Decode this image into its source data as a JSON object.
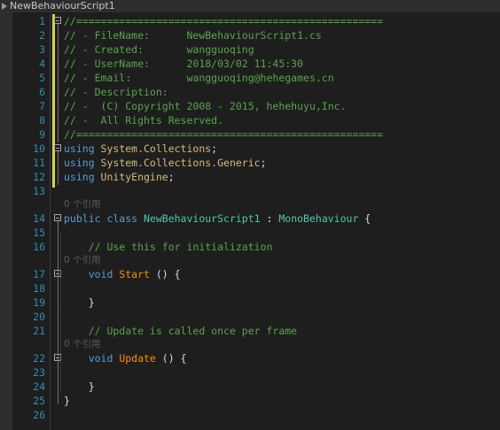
{
  "window": {
    "tab_title": "NewBehaviourScript1"
  },
  "editor": {
    "header_lines": [
      {
        "n": "1",
        "parts": [
          {
            "c": "cm",
            "t": "//=================================================="
          }
        ]
      },
      {
        "n": "2",
        "parts": [
          {
            "c": "cm",
            "t": "// - FileName:      NewBehaviourScript1.cs"
          }
        ]
      },
      {
        "n": "3",
        "parts": [
          {
            "c": "cm",
            "t": "// - Created:       wangguoqing"
          }
        ]
      },
      {
        "n": "4",
        "parts": [
          {
            "c": "cm",
            "t": "// - UserName:      2018/03/02 11:45:30"
          }
        ]
      },
      {
        "n": "5",
        "parts": [
          {
            "c": "cm",
            "t": "// - Email:         wangguoqing@hehegames.cn"
          }
        ]
      },
      {
        "n": "6",
        "parts": [
          {
            "c": "cm",
            "t": "// - Description:"
          }
        ]
      },
      {
        "n": "7",
        "parts": [
          {
            "c": "cm",
            "t": "// -  (C) Copyright 2008 - 2015, hehehuyu,Inc."
          }
        ]
      },
      {
        "n": "8",
        "parts": [
          {
            "c": "cm",
            "t": "// -  All Rights Reserved."
          }
        ]
      },
      {
        "n": "9",
        "parts": [
          {
            "c": "cm",
            "t": "//=================================================="
          }
        ]
      }
    ],
    "using_lines": [
      {
        "n": "10",
        "parts": [
          {
            "c": "kw",
            "t": "using "
          },
          {
            "c": "ns",
            "t": "System.Collections"
          },
          {
            "c": "pl",
            "t": ";"
          }
        ]
      },
      {
        "n": "11",
        "parts": [
          {
            "c": "kw",
            "t": "using "
          },
          {
            "c": "ns",
            "t": "System.Collections.Generic"
          },
          {
            "c": "pl",
            "t": ";"
          }
        ]
      },
      {
        "n": "12",
        "parts": [
          {
            "c": "kw",
            "t": "using "
          },
          {
            "c": "ns",
            "t": "UnityEngine"
          },
          {
            "c": "pl",
            "t": ";"
          }
        ]
      },
      {
        "n": "13",
        "parts": []
      }
    ],
    "class_ref": "0 个引用",
    "class_lines": [
      {
        "n": "14",
        "parts": [
          {
            "c": "kw",
            "t": "public class "
          },
          {
            "c": "ty",
            "t": "NewBehaviourScript1"
          },
          {
            "c": "pl",
            "t": " : "
          },
          {
            "c": "ty",
            "t": "MonoBehaviour"
          },
          {
            "c": "pl",
            "t": " {"
          }
        ]
      },
      {
        "n": "15",
        "parts": []
      },
      {
        "n": "16",
        "parts": [
          {
            "c": "cm",
            "t": "    // Use this for initialization"
          }
        ]
      }
    ],
    "start_ref": "0 个引用",
    "start_lines": [
      {
        "n": "17",
        "parts": [
          {
            "c": "kw",
            "t": "    void "
          },
          {
            "c": "fn",
            "t": "Start"
          },
          {
            "c": "pl",
            "t": " () {"
          }
        ]
      },
      {
        "n": "18",
        "parts": []
      },
      {
        "n": "19",
        "parts": [
          {
            "c": "pl",
            "t": "    }"
          }
        ]
      },
      {
        "n": "20",
        "parts": []
      },
      {
        "n": "21",
        "parts": [
          {
            "c": "cm",
            "t": "    // Update is called once per frame"
          }
        ]
      }
    ],
    "update_ref": "0 个引用",
    "update_lines": [
      {
        "n": "22",
        "parts": [
          {
            "c": "kw",
            "t": "    void "
          },
          {
            "c": "fn",
            "t": "Update"
          },
          {
            "c": "pl",
            "t": " () {"
          }
        ]
      },
      {
        "n": "23",
        "parts": []
      },
      {
        "n": "24",
        "parts": [
          {
            "c": "pl",
            "t": "    }"
          }
        ]
      },
      {
        "n": "25",
        "parts": [
          {
            "c": "pl",
            "t": "}"
          }
        ]
      },
      {
        "n": "26",
        "parts": []
      }
    ],
    "colors": {
      "background": "#1e1e1e",
      "line_number": "#2b91af",
      "comment": "#57a64a",
      "keyword": "#569cd6",
      "type": "#4ec9b0",
      "namespace": "#d7ba7d",
      "method": "#ff8c00",
      "codelens": "#5a5a5a"
    }
  }
}
